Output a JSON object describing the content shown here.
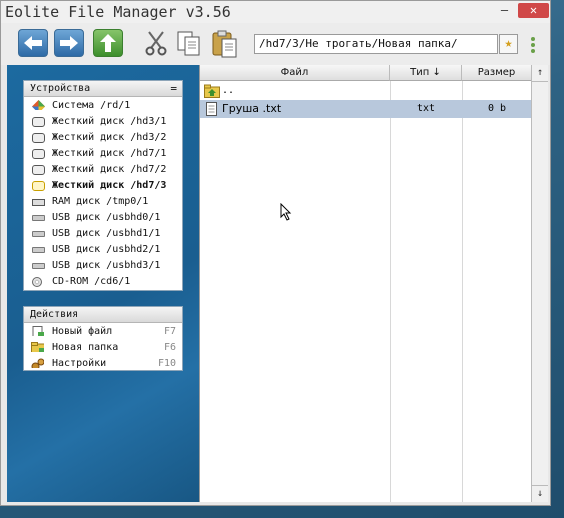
{
  "window": {
    "title": "Eolite File Manager v3.56",
    "minimize_glyph": "–",
    "close_glyph": "✕"
  },
  "toolbar": {
    "buttons": [
      "back",
      "forward",
      "up",
      "cut",
      "copy",
      "paste"
    ],
    "path": "/hd7/3/Не трогать/Новая папка/",
    "bookmark_glyph": "★"
  },
  "devices": {
    "title": "Устройства",
    "collapse_glyph": "=",
    "items": [
      {
        "label": "Система /rd/1",
        "icon": "system-icon"
      },
      {
        "label": "Жесткий диск /hd3/1",
        "icon": "hdd-icon"
      },
      {
        "label": "Жесткий диск /hd3/2",
        "icon": "hdd-icon"
      },
      {
        "label": "Жесткий диск /hd7/1",
        "icon": "hdd-icon"
      },
      {
        "label": "Жесткий диск /hd7/2",
        "icon": "hdd-icon"
      },
      {
        "label": "Жесткий диск /hd7/3",
        "icon": "hdd-icon",
        "active": true
      },
      {
        "label": "RAM диск /tmp0/1",
        "icon": "ram-icon"
      },
      {
        "label": "USB диск /usbhd0/1",
        "icon": "usb-icon"
      },
      {
        "label": "USB диск /usbhd1/1",
        "icon": "usb-icon"
      },
      {
        "label": "USB диск /usbhd2/1",
        "icon": "usb-icon"
      },
      {
        "label": "USB диск /usbhd3/1",
        "icon": "usb-icon"
      },
      {
        "label": "CD-ROM /cd6/1",
        "icon": "cdrom-icon"
      }
    ]
  },
  "actions": {
    "title": "Действия",
    "items": [
      {
        "label": "Новый файл",
        "key": "F7",
        "icon": "new-file-icon"
      },
      {
        "label": "Новая папка",
        "key": "F6",
        "icon": "new-folder-icon"
      },
      {
        "label": "Настройки",
        "key": "F10",
        "icon": "settings-icon"
      }
    ]
  },
  "files": {
    "columns": {
      "name": "Файл",
      "type": "Тип ↓",
      "size": "Размер",
      "sort": "↑"
    },
    "rows": [
      {
        "name": "..",
        "type": "",
        "size": "",
        "icon": "parent-folder-icon",
        "selected": false
      },
      {
        "name": "Груша .txt",
        "type": "txt",
        "size": "0 b",
        "icon": "text-file-icon",
        "selected": true
      }
    ]
  },
  "scrollbar": {
    "up": "↑",
    "down": "↓"
  },
  "colors": {
    "accent": "#1a5e90",
    "selection": "#b8c8dc",
    "close": "#d04848"
  }
}
